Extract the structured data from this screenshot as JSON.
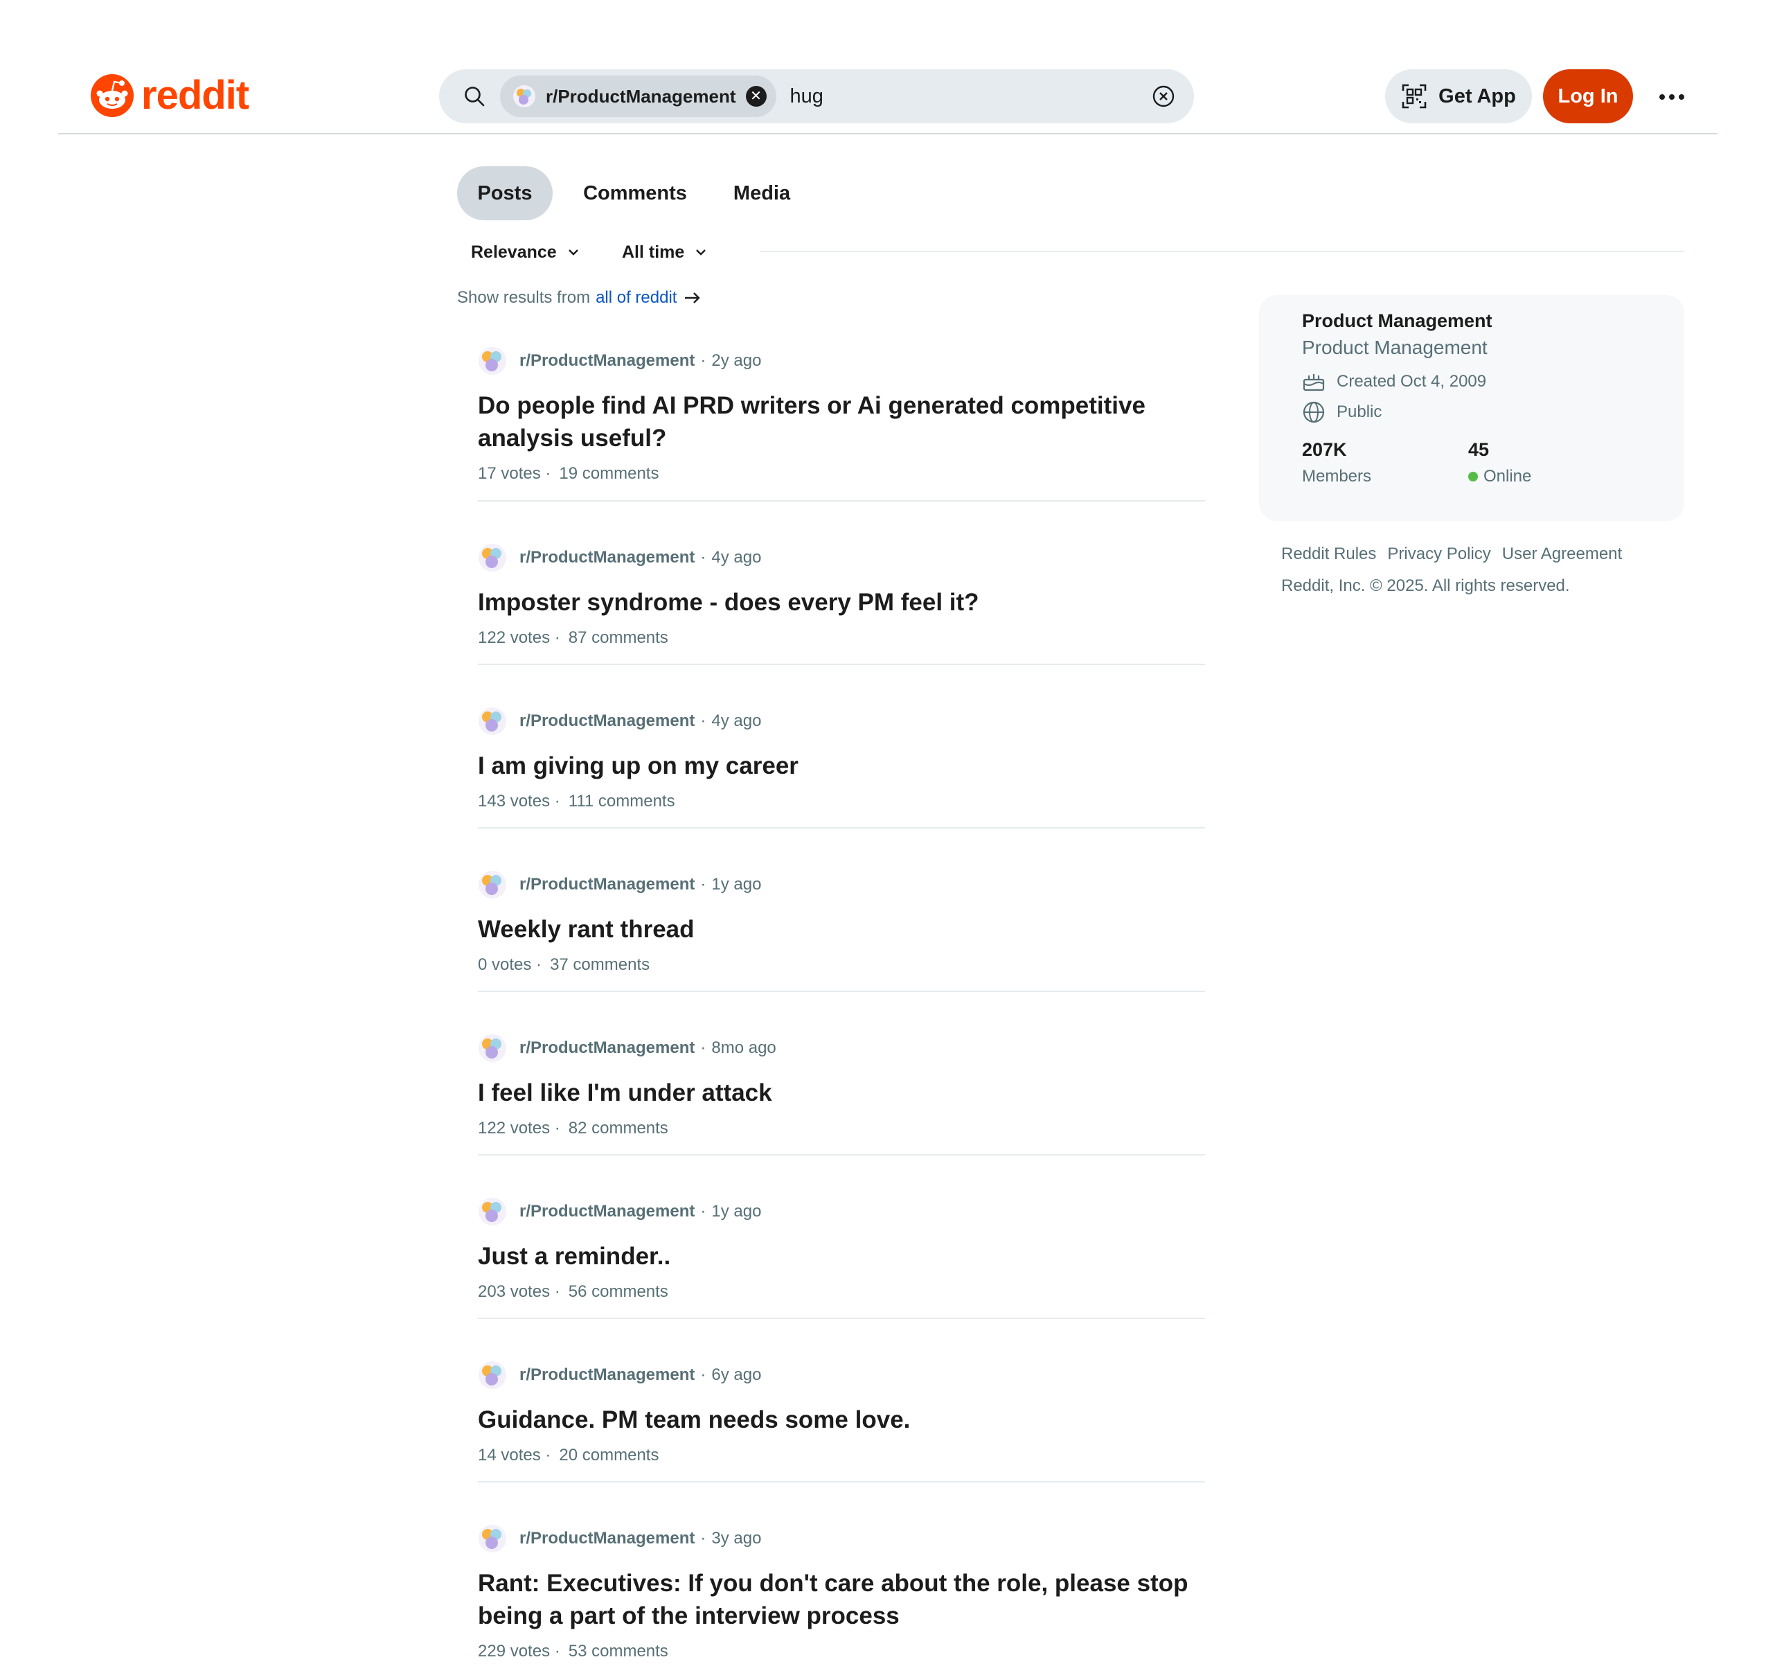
{
  "header": {
    "logo_text": "reddit",
    "brand_color": "#ff4500",
    "search": {
      "chip_label": "r/ProductManagement",
      "query": "hug"
    },
    "get_app_label": "Get App",
    "login_label": "Log In",
    "login_color": "#d93a00"
  },
  "tabs": [
    {
      "label": "Posts",
      "active": true
    },
    {
      "label": "Comments",
      "active": false
    },
    {
      "label": "Media",
      "active": false
    }
  ],
  "filters": {
    "sort": "Relevance",
    "time": "All time"
  },
  "show_results": {
    "prefix": "Show results from",
    "link": "all of reddit"
  },
  "posts": [
    {
      "subreddit": "r/ProductManagement",
      "age": "2y ago",
      "title": "Do people find AI PRD writers or Ai generated competitive analysis useful?",
      "votes": "17 votes",
      "comments": "19 comments"
    },
    {
      "subreddit": "r/ProductManagement",
      "age": "4y ago",
      "title": "Imposter syndrome - does every PM feel it?",
      "votes": "122 votes",
      "comments": "87 comments"
    },
    {
      "subreddit": "r/ProductManagement",
      "age": "4y ago",
      "title": "I am giving up on my career",
      "votes": "143 votes",
      "comments": "111 comments"
    },
    {
      "subreddit": "r/ProductManagement",
      "age": "1y ago",
      "title": "Weekly rant thread",
      "votes": "0 votes",
      "comments": "37 comments"
    },
    {
      "subreddit": "r/ProductManagement",
      "age": "8mo ago",
      "title": "I feel like I'm under attack",
      "votes": "122 votes",
      "comments": "82 comments"
    },
    {
      "subreddit": "r/ProductManagement",
      "age": "1y ago",
      "title": "Just a reminder..",
      "votes": "203 votes",
      "comments": "56 comments"
    },
    {
      "subreddit": "r/ProductManagement",
      "age": "6y ago",
      "title": "Guidance. PM team needs some love.",
      "votes": "14 votes",
      "comments": "20 comments"
    },
    {
      "subreddit": "r/ProductManagement",
      "age": "3y ago",
      "title": "Rant: Executives: If you don't care about the role, please stop being a part of the interview process",
      "votes": "229 votes",
      "comments": "53 comments"
    }
  ],
  "sidebar": {
    "title": "Product Management",
    "subtitle": "Product Management",
    "created": "Created Oct 4, 2009",
    "visibility": "Public",
    "members_count": "207K",
    "members_label": "Members",
    "online_count": "45",
    "online_label": "Online",
    "online_color": "#55bd46"
  },
  "footer": {
    "links": [
      "Reddit Rules",
      "Privacy Policy",
      "User Agreement"
    ],
    "copyright": "Reddit, Inc. © 2025. All rights reserved."
  }
}
